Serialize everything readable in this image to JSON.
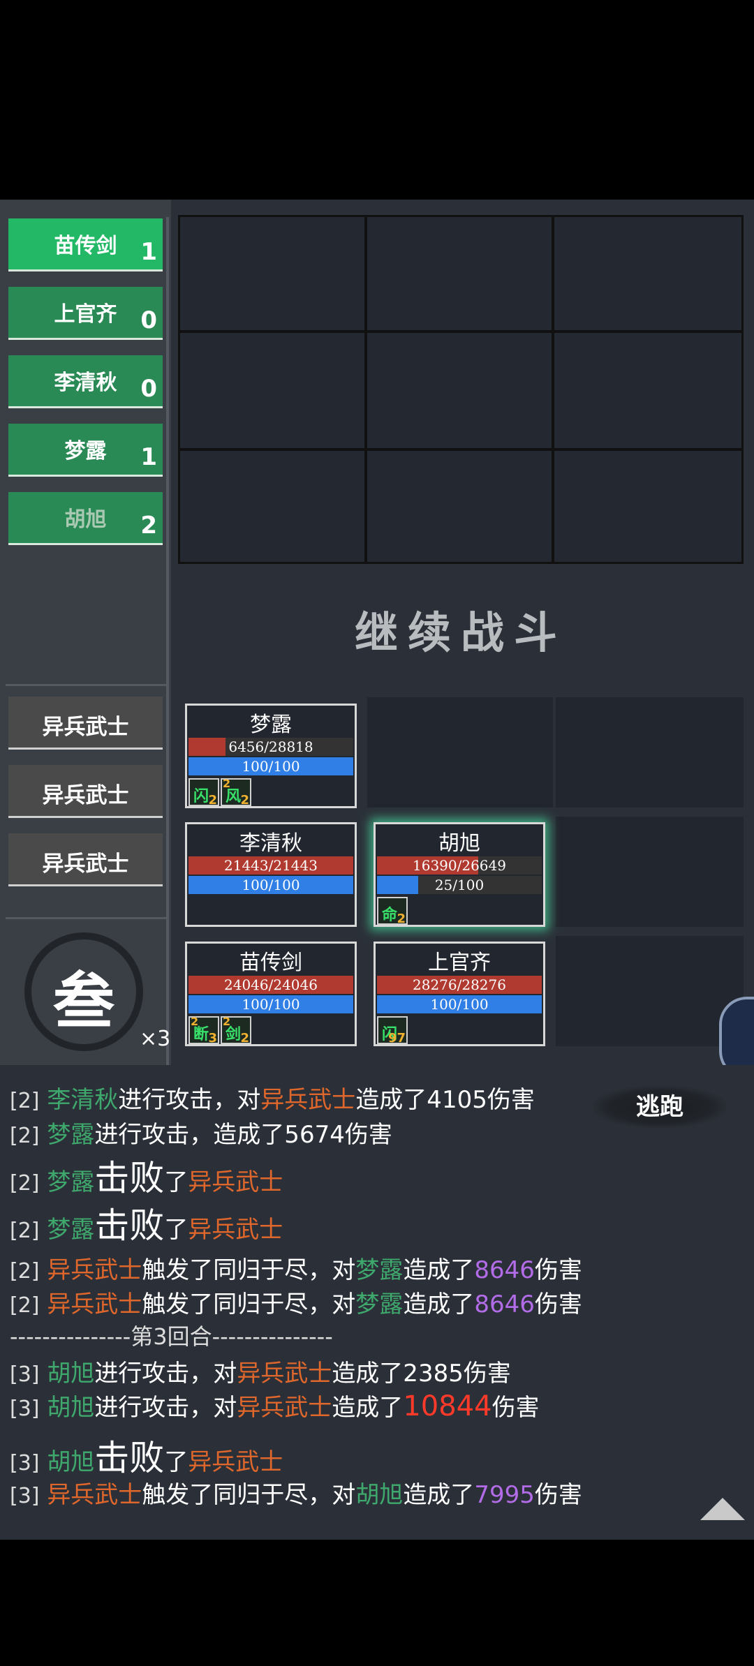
{
  "allies": [
    {
      "name": "苗传剑",
      "count": "1"
    },
    {
      "name": "上官齐",
      "count": "0"
    },
    {
      "name": "李清秋",
      "count": "0"
    },
    {
      "name": "梦露",
      "count": "1"
    },
    {
      "name": "胡旭",
      "count": "2"
    }
  ],
  "enemies": [
    "异兵武士",
    "异兵武士",
    "异兵武士"
  ],
  "continue_label": "继续战斗",
  "round_char": "叁",
  "speed": "×3",
  "flee_label": "逃跑",
  "cards": {
    "menglu": {
      "name": "梦露",
      "hp": "6456/28818",
      "hp_frac": 0.224,
      "mp": "100/100",
      "mp_frac": 1.0,
      "buffs": [
        {
          "glyph": "闪",
          "num": "2",
          "pre": ""
        },
        {
          "glyph": "风",
          "num": "2",
          "pre": "2"
        }
      ]
    },
    "liqingqiu": {
      "name": "李清秋",
      "hp": "21443/21443",
      "hp_frac": 1.0,
      "mp": "100/100",
      "mp_frac": 1.0
    },
    "huxu": {
      "name": "胡旭",
      "hp": "16390/26649",
      "hp_frac": 0.615,
      "mp": "25/100",
      "mp_frac": 0.25,
      "buffs": [
        {
          "glyph": "命",
          "num": "2",
          "pre": ""
        }
      ]
    },
    "miaochuanjian": {
      "name": "苗传剑",
      "hp": "24046/24046",
      "hp_frac": 1.0,
      "mp": "100/100",
      "mp_frac": 1.0,
      "buffs": [
        {
          "glyph": "断",
          "num": "3",
          "pre": "2"
        },
        {
          "glyph": "剑",
          "num": "2",
          "pre": "2"
        }
      ]
    },
    "shangguanqi": {
      "name": "上官齐",
      "hp": "28276/28276",
      "hp_frac": 1.0,
      "mp": "100/100",
      "mp_frac": 1.0,
      "buffs": [
        {
          "glyph": "闪",
          "num": "97",
          "pre": ""
        }
      ]
    }
  },
  "log": {
    "l1": {
      "round": "[2]",
      "a": "李清秋",
      "b": "进行攻击，对",
      "c": "异兵武士",
      "d": "造成了4105伤害"
    },
    "l2": {
      "round": "[2]",
      "a": "梦露",
      "b": "进行攻击，造成了5674伤害"
    },
    "l3": {
      "round": "[2]",
      "a": "梦露",
      "big": "击败",
      "b": "了",
      "c": "异兵武士"
    },
    "l4": {
      "round": "[2]",
      "a": "梦露",
      "big": "击败",
      "b": "了",
      "c": "异兵武士"
    },
    "l5": {
      "round": "[2]",
      "a": "异兵武士",
      "b": "触发了同归于尽，对",
      "c": "梦露",
      "d": "造成了",
      "e": "8646",
      "f": "伤害"
    },
    "l6": {
      "round": "[2]",
      "a": "异兵武士",
      "b": "触发了同归于尽，对",
      "c": "梦露",
      "d": "造成了",
      "e": "8646",
      "f": "伤害"
    },
    "l7": "---------------第3回合---------------",
    "l8": {
      "round": "[3]",
      "a": "胡旭",
      "b": "进行攻击，对",
      "c": "异兵武士",
      "d": "造成了2385伤害"
    },
    "l9": {
      "round": "[3]",
      "a": "胡旭",
      "b": "进行攻击，对",
      "c": "异兵武士",
      "d": "造成了",
      "e": "10844",
      "f": "伤害"
    },
    "l10": {
      "round": "[3]",
      "a": "胡旭",
      "big": "击败",
      "b": "了",
      "c": "异兵武士"
    },
    "l11": {
      "round": "[3]",
      "a": "异兵武士",
      "b": "触发了同归于尽，对",
      "c": "胡旭",
      "d": "造成了",
      "e": "7995",
      "f": "伤害"
    }
  }
}
